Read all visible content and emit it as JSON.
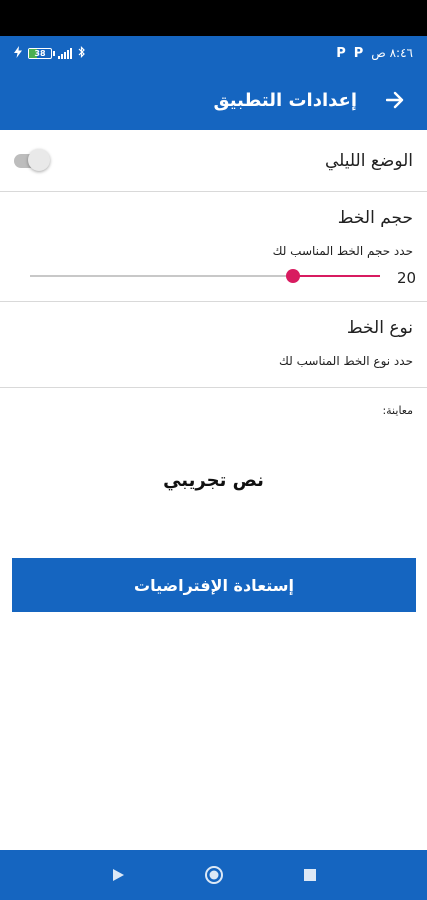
{
  "status_bar": {
    "time": "٨:٤٦ ص",
    "battery_label": "38",
    "battery_level": 0.38,
    "notification_icons": [
      "P",
      "P"
    ]
  },
  "app_bar": {
    "title": "إعدادات التطبيق",
    "back_icon": "arrow-right-icon"
  },
  "settings": {
    "night_mode": {
      "label": "الوضع الليلي",
      "enabled": false
    },
    "font_size": {
      "title": "حجم الخط",
      "subtitle": "حدد حجم الخط المناسب لك",
      "value": "20",
      "slider_fraction": 0.75
    },
    "font_type": {
      "title": "نوع الخط",
      "subtitle": "حدد نوع الخط المناسب لك"
    }
  },
  "preview": {
    "label": "معاينة:",
    "sample_text": "نص تجريبي"
  },
  "restore_button": {
    "label": "إستعادة الإفتراضيات"
  },
  "colors": {
    "primary": "#1565c0",
    "accent": "#d81b60"
  }
}
